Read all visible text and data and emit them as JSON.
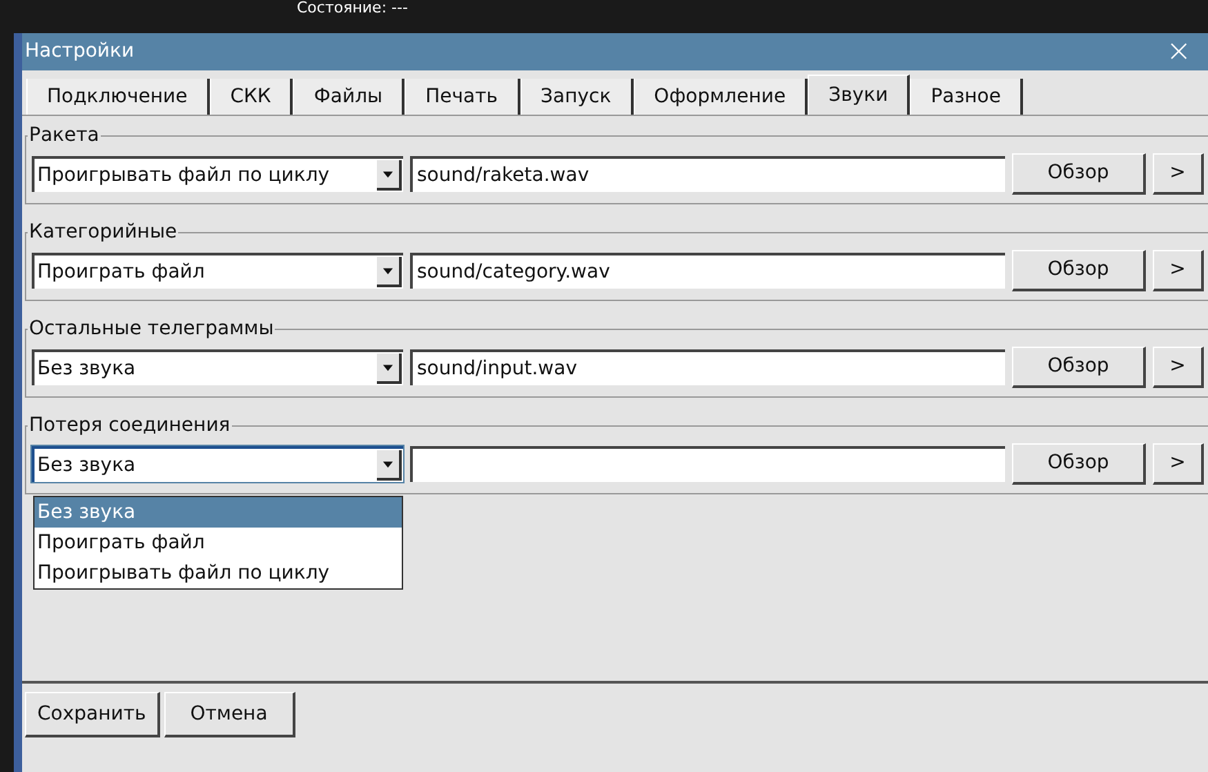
{
  "background": {
    "status_label": "Состояние: ---"
  },
  "window": {
    "title": "Настройки",
    "close": "×"
  },
  "tabs": [
    {
      "label": "Подключение",
      "selected": false
    },
    {
      "label": "СКК",
      "selected": false
    },
    {
      "label": "Файлы",
      "selected": false
    },
    {
      "label": "Печать",
      "selected": false
    },
    {
      "label": "Запуск",
      "selected": false
    },
    {
      "label": "Оформление",
      "selected": false
    },
    {
      "label": "Звуки",
      "selected": true
    },
    {
      "label": "Разное",
      "selected": false
    }
  ],
  "groups": [
    {
      "legend": "Ракета",
      "mode": "Проигрывать файл по циклу",
      "path": "sound/raketa.wav",
      "browse": "Обзор",
      "more": ">",
      "open": false
    },
    {
      "legend": "Категорийные",
      "mode": "Проиграть файл",
      "path": "sound/category.wav",
      "browse": "Обзор",
      "more": ">",
      "open": false
    },
    {
      "legend": "Остальные телеграммы",
      "mode": "Без звука",
      "path": "sound/input.wav",
      "browse": "Обзор",
      "more": ">",
      "open": false
    },
    {
      "legend": "Потеря соединения",
      "mode": "Без звука",
      "browse": "Обзор",
      "more": ">",
      "open": true
    }
  ],
  "dropdown_options": [
    {
      "label": "Без звука",
      "selected": true
    },
    {
      "label": "Проиграть файл",
      "selected": false
    },
    {
      "label": "Проигрывать файл по циклу",
      "selected": false
    }
  ],
  "buttons": [
    "Сохранить",
    "Отмена"
  ]
}
